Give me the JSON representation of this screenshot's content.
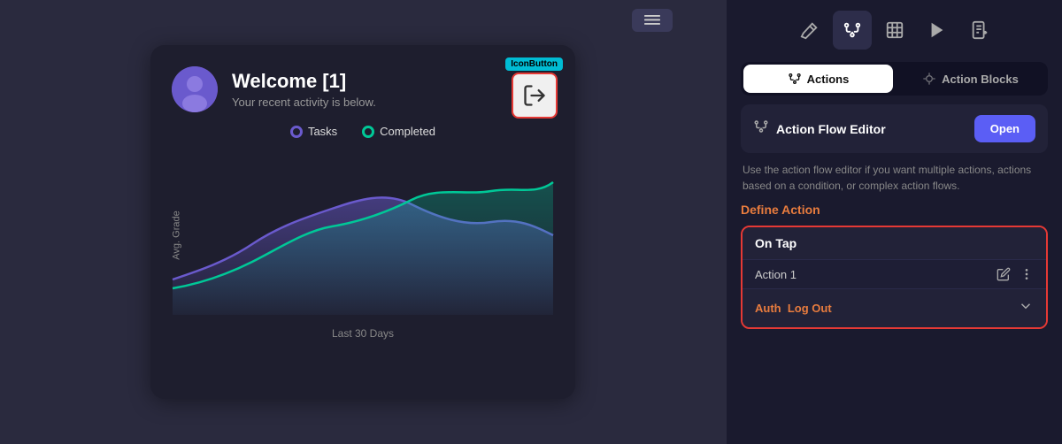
{
  "topBar": {
    "btnLabel": "≡"
  },
  "card": {
    "title": "Welcome [1]",
    "subtitle": "Your recent activity is below.",
    "iconButtonBadge": "IconButton",
    "legend": {
      "tasks": "Tasks",
      "completed": "Completed"
    },
    "xLabel": "Last 30 Days",
    "yLabel": "Avg. Grade"
  },
  "rightPanel": {
    "toolbar": {
      "icons": [
        "wand",
        "flow",
        "table",
        "play",
        "note-add"
      ]
    },
    "tabs": {
      "actions": "Actions",
      "actionBlocks": "Action Blocks"
    },
    "flowEditor": {
      "label": "Action Flow Editor",
      "openBtn": "Open"
    },
    "description": "Use the action flow editor if you want multiple actions, actions based on a condition, or complex action flows.",
    "defineAction": "Define Action",
    "onTap": {
      "title": "On Tap",
      "actionLabel": "Action 1",
      "authLabel": "Auth",
      "authAction": "Log Out"
    }
  }
}
